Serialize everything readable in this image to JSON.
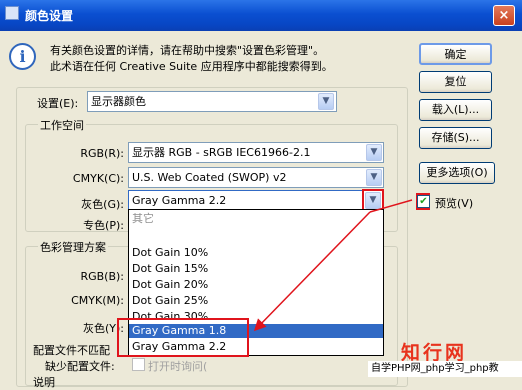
{
  "window": {
    "title": "颜色设置",
    "close_symbol": "×"
  },
  "info": {
    "line1": "有关颜色设置的详情，请在帮助中搜索\"设置色彩管理\"。",
    "line2": "此术语在任何 Creative Suite 应用程序中都能搜索得到。"
  },
  "settings": {
    "label": "设置(E):",
    "value": "显示器颜色"
  },
  "working_space": {
    "title": "工作空间",
    "rgb": {
      "label": "RGB(R):",
      "value": "显示器 RGB - sRGB IEC61966-2.1"
    },
    "cmyk": {
      "label": "CMYK(C):",
      "value": "U.S. Web Coated (SWOP) v2"
    },
    "gray": {
      "label": "灰色(G):",
      "value": "Gray Gamma 2.2"
    },
    "spot": {
      "label": "专色(P):"
    }
  },
  "color_management": {
    "title": "色彩管理方案",
    "rgb_label": "RGB(B):",
    "cmyk_label": "CMYK(M):",
    "gray_label": "灰色(Y):",
    "profile_mismatch_label": "配置文件不匹配",
    "missing_profiles_label": "缺少配置文件:",
    "ask_when_opening": "打开时询问(",
    "trailing_label": "说明"
  },
  "dropdown_options": [
    {
      "label": "其它",
      "state": "disabled"
    },
    {
      "label": "Dot Gain 10%",
      "state": "normal"
    },
    {
      "label": "Dot Gain 15%",
      "state": "normal"
    },
    {
      "label": "Dot Gain 20%",
      "state": "normal"
    },
    {
      "label": "Dot Gain 25%",
      "state": "normal"
    },
    {
      "label": "Dot Gain 30%",
      "state": "normal"
    },
    {
      "label": "Gray Gamma 1.8",
      "state": "selected"
    },
    {
      "label": "Gray Gamma 2.2",
      "state": "normal"
    }
  ],
  "buttons": {
    "ok": "确定",
    "reset": "复位",
    "load": "载入(L)...",
    "save": "存储(S)...",
    "more_options": "更多选项(O)"
  },
  "preview": {
    "label": "预览(V)",
    "checked": true
  },
  "watermark": {
    "brand": "知行网",
    "sub": "自学PHP网_php学习_php教"
  },
  "colors": {
    "title_bar": "#0a4fd1",
    "highlight": "#316ac5",
    "annotation_red": "#e0141c"
  },
  "icons": {
    "info": "info-icon",
    "combo": "chevron-down-icon",
    "preview_check": "checkmark-icon"
  }
}
